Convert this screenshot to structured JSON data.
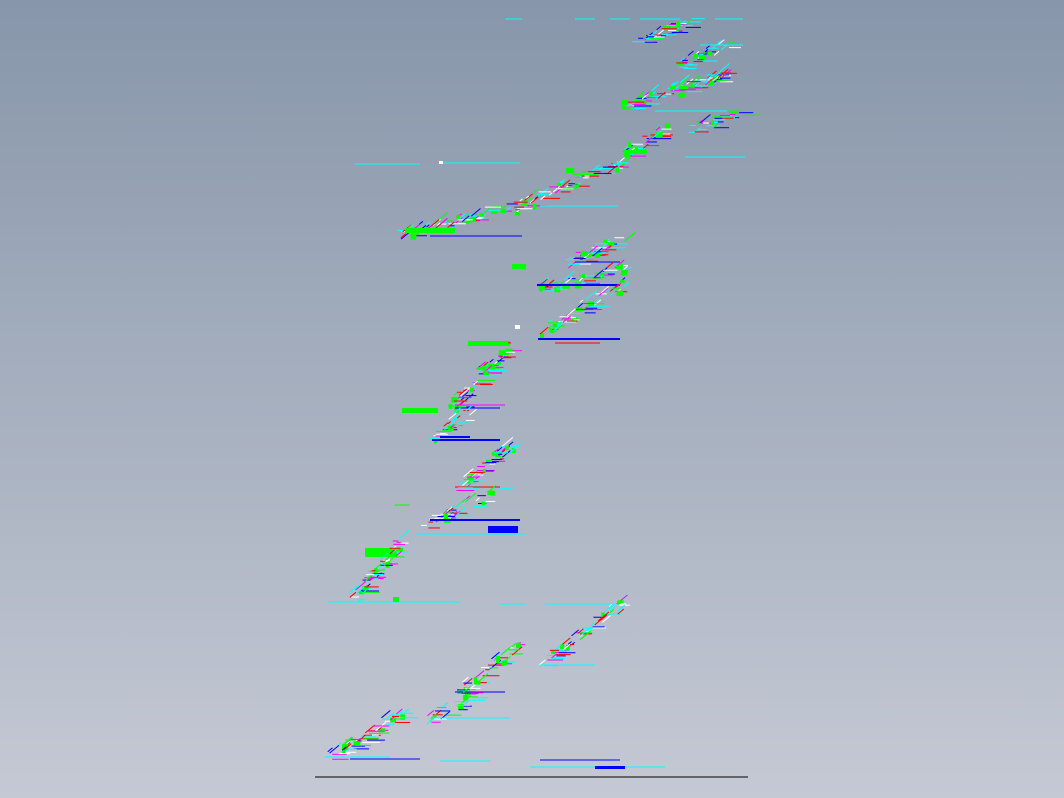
{
  "viewport": {
    "background_top": "#8796aa",
    "background_bottom": "#c5c9d4"
  },
  "palette": {
    "cyan": "#00ffff",
    "green": "#00ff00",
    "blue": "#0000ff",
    "magenta": "#ff00ff",
    "red": "#ff0000",
    "white": "#ffffff",
    "black": "#000000"
  },
  "drawing": {
    "description_icon": "cad-drawing-view-icon"
  }
}
